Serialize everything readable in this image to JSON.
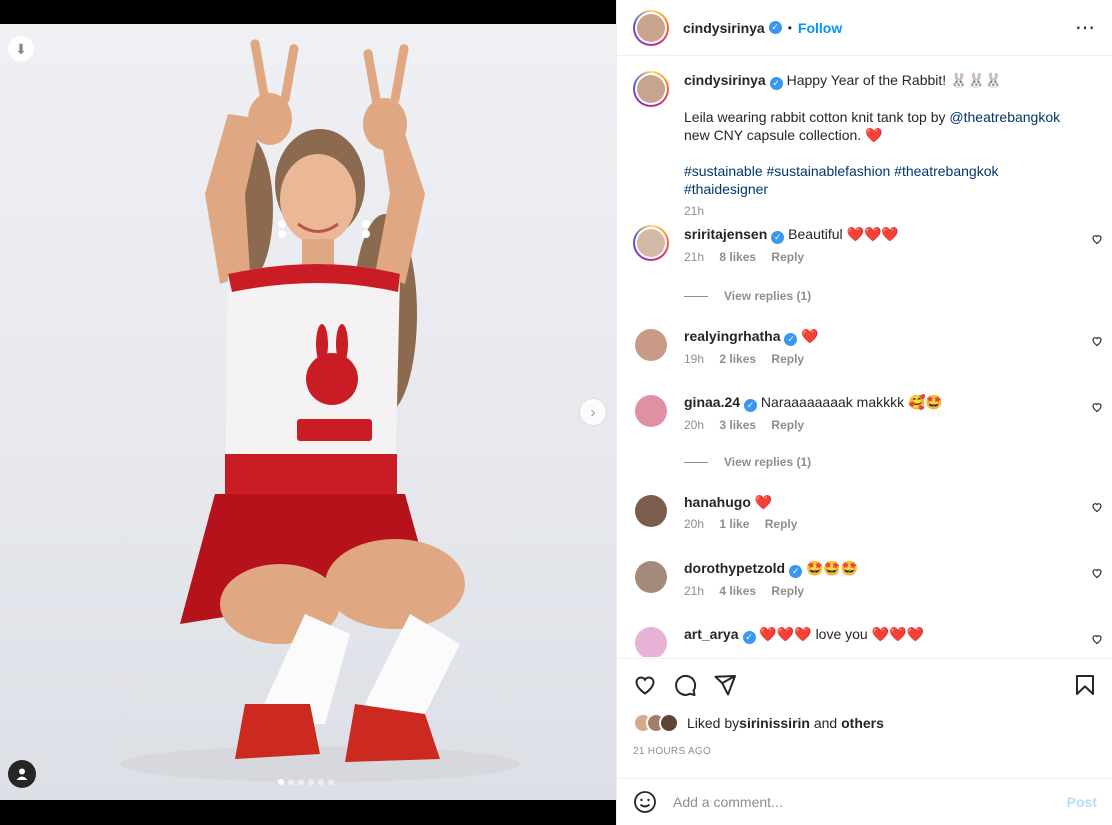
{
  "post": {
    "author": "cindysirinya",
    "follow_label": "Follow",
    "separator": "•",
    "more_icon": "more-options-icon"
  },
  "caption": {
    "author": "cindysirinya",
    "line1": "Happy Year of the Rabbit! 🐰🐰🐰",
    "line2_prefix": "Leila wearing rabbit cotton knit tank top by ",
    "mention": "@theatrebangkok",
    "line3": "new CNY capsule collection. ❤️",
    "hashtags": [
      "#sustainable",
      "#sustainablefashion",
      "#theatrebangkok",
      "#thaidesigner"
    ],
    "time": "21h"
  },
  "comments": [
    {
      "user": "sriritajensen",
      "verified": true,
      "text": "Beautiful ❤️❤️❤️",
      "time": "21h",
      "likes": "8 likes",
      "reply": "Reply",
      "view_replies": "View replies (1)"
    },
    {
      "user": "realyingrhatha",
      "verified": true,
      "text": "❤️",
      "time": "19h",
      "likes": "2 likes",
      "reply": "Reply"
    },
    {
      "user": "ginaa.24",
      "verified": true,
      "text": "Naraaaaaaaak makkkk 🥰🤩",
      "time": "20h",
      "likes": "3 likes",
      "reply": "Reply",
      "view_replies": "View replies (1)"
    },
    {
      "user": "hanahugo",
      "verified": false,
      "text": "❤️",
      "time": "20h",
      "likes": "1 like",
      "reply": "Reply"
    },
    {
      "user": "dorothypetzold",
      "verified": true,
      "text": "🤩🤩🤩",
      "time": "21h",
      "likes": "4 likes",
      "reply": "Reply"
    },
    {
      "user": "art_arya",
      "verified": true,
      "text": "❤️❤️❤️ love you ❤️❤️❤️"
    }
  ],
  "liked_by": {
    "prefix": "Liked by ",
    "user": "sirinissirin",
    "and": " and ",
    "others": "others"
  },
  "timestamp": "21 HOURS AGO",
  "add_comment": {
    "placeholder": "Add a comment...",
    "post_label": "Post"
  },
  "carousel": {
    "total": 6,
    "active_index": 0
  },
  "colors": {
    "link": "#00376b",
    "follow": "#0095f6",
    "verified": "#3897f0",
    "muted": "#8e8e8e"
  }
}
